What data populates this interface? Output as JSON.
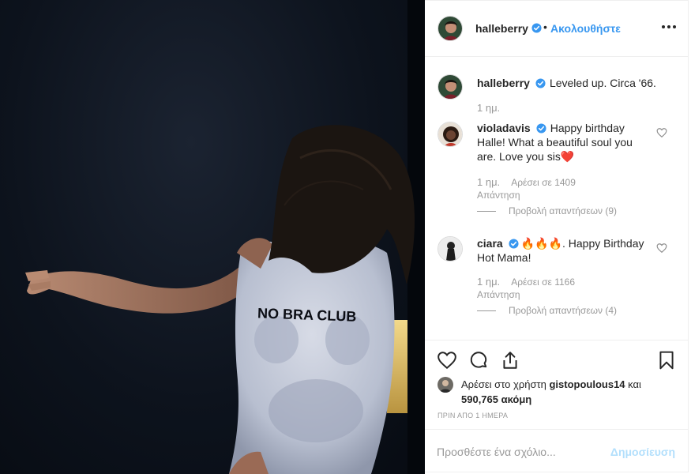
{
  "photo": {
    "shirt_text": "NO BRA CLUB",
    "colors": {
      "background": "#0b111a",
      "shirt": "#c9cfdd",
      "skin": "#9a6a55",
      "hair": "#1a1512",
      "window": "#e8c870"
    }
  },
  "header": {
    "username": "halleberry",
    "separator": "•",
    "follow_label": "Ακολουθήστε"
  },
  "caption": {
    "username": "halleberry",
    "text": "Leveled up. Circa '66.",
    "time": "1 ημ."
  },
  "comments": [
    {
      "username": "violadavis",
      "text": "Happy birthday Halle! What a beautiful soul you are. Love you sis❤️",
      "time": "1 ημ.",
      "likes": "Αρέσει σε 1409",
      "reply": "Απάντηση",
      "view_replies": "Προβολή απαντήσεων (9)"
    },
    {
      "username": "ciara",
      "text": "🔥🔥🔥. Happy Birthday Hot Mama!",
      "time": "1 ημ.",
      "likes": "Αρέσει σε 1166",
      "reply": "Απάντηση",
      "view_replies": "Προβολή απαντήσεων (4)"
    }
  ],
  "likes": {
    "prefix": "Αρέσει στο χρήστη",
    "user": "gistopoulous14",
    "conjunction": "και",
    "count": "590,765 ακόμη"
  },
  "timestamp": "ΠΡΙΝ ΑΠΟ 1 ΗΜΕΡΑ",
  "comment_box": {
    "placeholder": "Προσθέστε ένα σχόλιο...",
    "post_label": "Δημοσίευση"
  },
  "icons": [
    "heart-icon",
    "comment-icon",
    "share-icon",
    "bookmark-icon",
    "verified-badge-icon",
    "more-options-icon"
  ],
  "accent_color": "#3897f0"
}
